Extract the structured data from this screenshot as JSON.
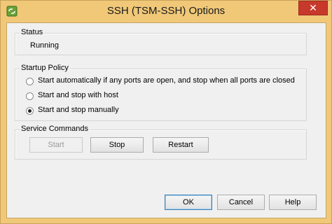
{
  "window": {
    "title": "SSH (TSM-SSH) Options",
    "close_glyph": "✕",
    "icon": "vsphere-app-icon"
  },
  "status": {
    "legend": "Status",
    "value": "Running"
  },
  "startup_policy": {
    "legend": "Startup Policy",
    "options": [
      {
        "label": "Start automatically if any ports are open, and stop when all ports are closed",
        "selected": false
      },
      {
        "label": "Start and stop with host",
        "selected": false
      },
      {
        "label": "Start and stop manually",
        "selected": true
      }
    ]
  },
  "service_commands": {
    "legend": "Service Commands",
    "start_label": "Start",
    "stop_label": "Stop",
    "restart_label": "Restart"
  },
  "footer": {
    "ok_label": "OK",
    "cancel_label": "Cancel",
    "help_label": "Help"
  }
}
